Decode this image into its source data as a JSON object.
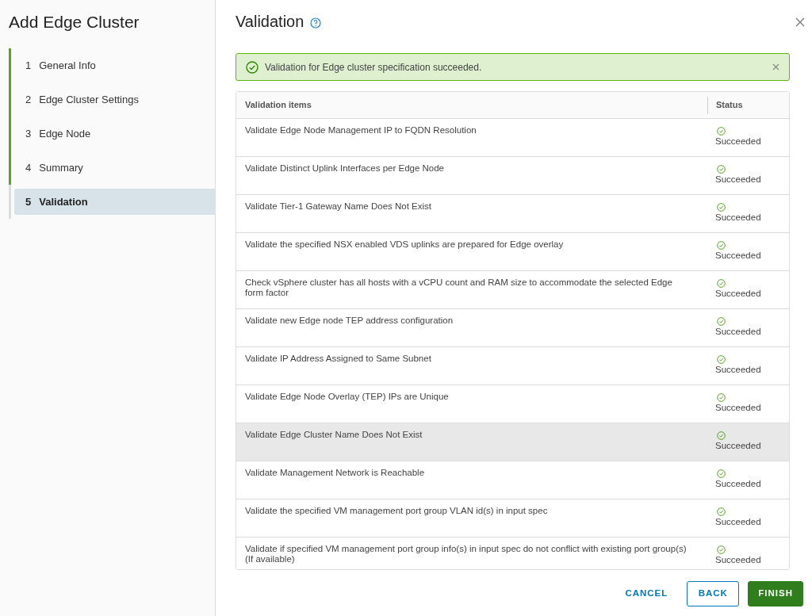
{
  "wizard": {
    "title": "Add Edge Cluster"
  },
  "steps": [
    {
      "number": "1",
      "label": "General Info",
      "completed": true,
      "selected": false
    },
    {
      "number": "2",
      "label": "Edge Cluster Settings",
      "completed": true,
      "selected": false
    },
    {
      "number": "3",
      "label": "Edge Node",
      "completed": true,
      "selected": false
    },
    {
      "number": "4",
      "label": "Summary",
      "completed": true,
      "selected": false
    },
    {
      "number": "5",
      "label": "Validation",
      "completed": false,
      "selected": true
    }
  ],
  "page": {
    "title": "Validation"
  },
  "alert": {
    "message": "Validation for Edge cluster specification succeeded.",
    "kind": "success"
  },
  "table": {
    "columns": [
      "Validation items",
      "Status"
    ],
    "rows": [
      {
        "item": "Validate Edge Node Management IP to FQDN Resolution",
        "status": "Succeeded",
        "highlighted": false
      },
      {
        "item": "Validate Distinct Uplink Interfaces per Edge Node",
        "status": "Succeeded",
        "highlighted": false
      },
      {
        "item": "Validate Tier-1 Gateway Name Does Not Exist",
        "status": "Succeeded",
        "highlighted": false
      },
      {
        "item": "Validate the specified NSX enabled VDS uplinks are prepared for Edge overlay",
        "status": "Succeeded",
        "highlighted": false
      },
      {
        "item": "Check vSphere cluster has all hosts with a vCPU count and RAM size to accommodate the selected Edge form factor",
        "status": "Succeeded",
        "highlighted": false
      },
      {
        "item": "Validate new Edge node TEP address configuration",
        "status": "Succeeded",
        "highlighted": false
      },
      {
        "item": "Validate IP Address Assigned to Same Subnet",
        "status": "Succeeded",
        "highlighted": false
      },
      {
        "item": "Validate Edge Node Overlay (TEP) IPs are Unique",
        "status": "Succeeded",
        "highlighted": false
      },
      {
        "item": "Validate Edge Cluster Name Does Not Exist",
        "status": "Succeeded",
        "highlighted": true
      },
      {
        "item": "Validate Management Network is Reachable",
        "status": "Succeeded",
        "highlighted": false
      },
      {
        "item": "Validate the specified VM management port group VLAN id(s) in input spec",
        "status": "Succeeded",
        "highlighted": false
      },
      {
        "item": "Validate if specified VM management port group info(s) in input spec do not conflict with existing port group(s) (If available)",
        "status": "Succeeded",
        "highlighted": false
      }
    ]
  },
  "buttons": [
    {
      "label": "CANCEL",
      "kind": "flat"
    },
    {
      "label": "BACK",
      "kind": "outline"
    },
    {
      "label": "FINISH",
      "kind": "primary"
    }
  ]
}
